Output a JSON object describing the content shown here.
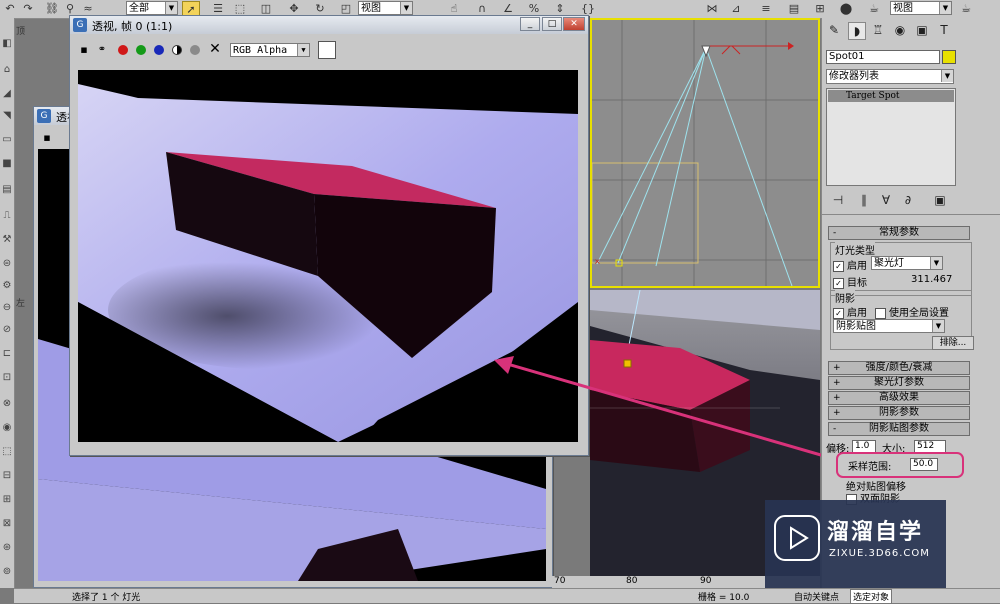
{
  "toolbar": {
    "selection_filter": "全部",
    "ref_coord": "视图",
    "ref_coord_right": "视图"
  },
  "render_window": {
    "title": "透视, 帧 0 (1:1)",
    "channel": "RGB Alpha"
  },
  "back_window": {
    "title": "透视"
  },
  "side_labels": {
    "top": "顶",
    "left": "左"
  },
  "command_panel": {
    "object_name": "Spot01",
    "modifier_list": "修改器列表",
    "stack_item": "Target Spot",
    "rollouts": {
      "general": "常规参数",
      "light_type": "灯光类型",
      "enable": "启用",
      "light_type_value": "聚光灯",
      "target": "目标",
      "target_distance": "311.467",
      "shadows": "阴影",
      "shadow_enable": "启用",
      "use_global": "使用全局设置",
      "shadow_type": "阴影贴图",
      "exclude": "排除...",
      "intensity": "强度/颜色/衰减",
      "spotlight": "聚光灯参数",
      "advanced": "高级效果",
      "shadow_params": "阴影参数",
      "shadow_map_params": "阴影贴图参数",
      "bias_label": "偏移:",
      "bias_value": "1.0",
      "size_label": "大小:",
      "size_value": "512",
      "sample_range_label": "采样范围:",
      "sample_range_value": "50.0",
      "absolute_bias": "绝对贴图偏移",
      "two_sided": "双面阴影"
    }
  },
  "timeline": {
    "ticks": [
      "70",
      "80",
      "90"
    ]
  },
  "status": {
    "selected": "选择了 1 个 灯光",
    "grid": "栅格 = 10.0",
    "auto_key": "自动关键点",
    "selected_obj": "选定对象"
  },
  "watermark": {
    "name": "溜溜自学",
    "url": "ZIXUE.3D66.COM"
  },
  "colors": {
    "accent_highlight": "#d8327a",
    "box_top": "#c8285e",
    "floor": "#a6a3e6"
  }
}
